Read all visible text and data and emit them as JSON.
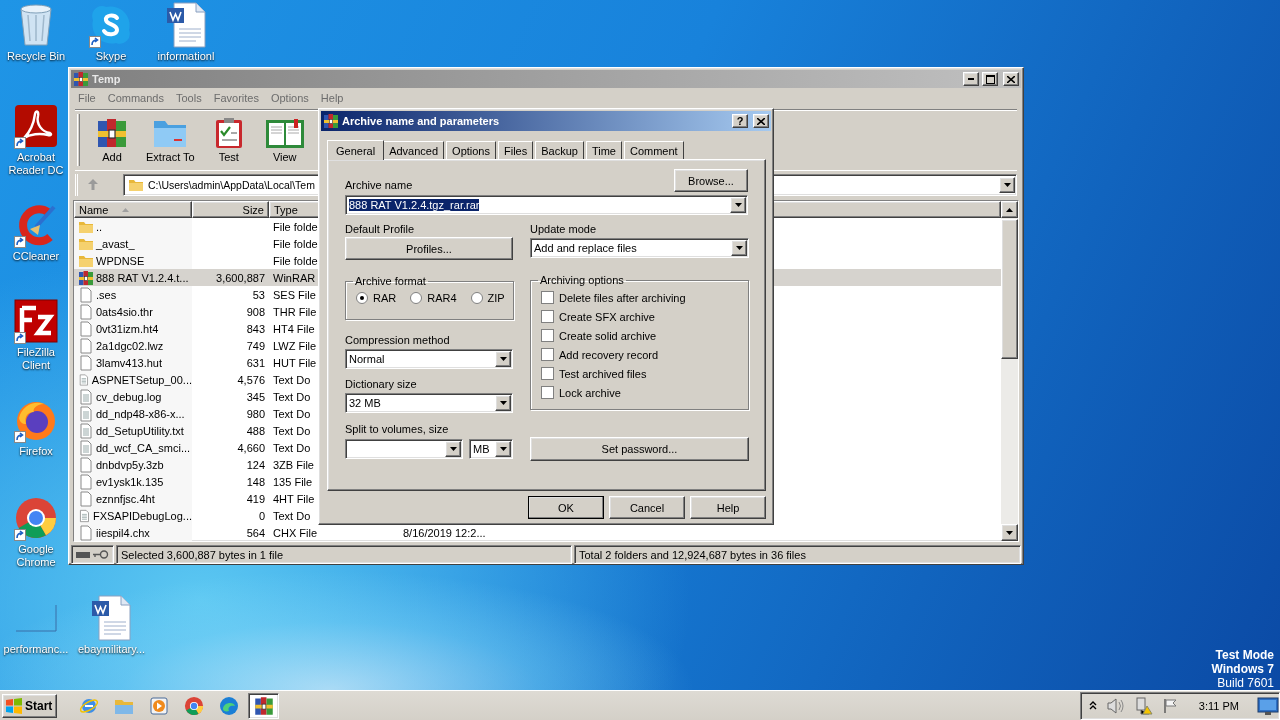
{
  "desktop_icons": [
    {
      "kind": "recycle",
      "label": "Recycle Bin",
      "shortcut": false
    },
    {
      "kind": "chat",
      "label": "Skype",
      "shortcut": true
    },
    {
      "kind": "document",
      "label": "informationl",
      "shortcut": false
    },
    {
      "kind": "pdf",
      "label": "Acrobat Reader DC",
      "shortcut": true
    },
    {
      "kind": "cleaner",
      "label": "CCleaner",
      "shortcut": true
    },
    {
      "kind": "ftp",
      "label": "FileZilla Client",
      "shortcut": true
    },
    {
      "kind": "firefox",
      "label": "Firefox",
      "shortcut": true
    },
    {
      "kind": "chrome",
      "label": "Google Chrome",
      "shortcut": true
    },
    {
      "kind": "blank",
      "label": "performanc...",
      "shortcut": false
    },
    {
      "kind": "document",
      "label": "ebaymilitary...",
      "shortcut": false
    }
  ],
  "main_window": {
    "title": "Temp",
    "menu": [
      "File",
      "Commands",
      "Tools",
      "Favorites",
      "Options",
      "Help"
    ],
    "toolbar": [
      {
        "kind": "add",
        "label": "Add"
      },
      {
        "kind": "extract",
        "label": "Extract To"
      },
      {
        "kind": "test",
        "label": "Test"
      },
      {
        "kind": "view",
        "label": "View"
      }
    ],
    "path": "C:\\Users\\admin\\AppData\\Local\\Tem",
    "columns": [
      "Name",
      "Size",
      "Type"
    ],
    "files": [
      {
        "kind": "folder",
        "name": "..",
        "type": "File folde",
        "selected": false
      },
      {
        "kind": "folder",
        "name": "_avast_",
        "type": "File folde",
        "selected": false
      },
      {
        "kind": "folder",
        "name": "WPDNSE",
        "type": "File folde",
        "selected": false
      },
      {
        "kind": "archive",
        "name": "888 RAT V1.2.4.t...",
        "size": "3,600,887",
        "type": "WinRAR",
        "selected": true
      },
      {
        "kind": "file",
        "name": ".ses",
        "size": "53",
        "type": "SES File",
        "selected": false
      },
      {
        "kind": "file",
        "name": "0ats4sio.thr",
        "size": "908",
        "type": "THR File",
        "selected": false
      },
      {
        "kind": "file",
        "name": "0vt31izm.ht4",
        "size": "843",
        "type": "HT4 File",
        "selected": false
      },
      {
        "kind": "file",
        "name": "2a1dgc02.lwz",
        "size": "749",
        "type": "LWZ File",
        "selected": false
      },
      {
        "kind": "file",
        "name": "3lamv413.hut",
        "size": "631",
        "type": "HUT File",
        "selected": false
      },
      {
        "kind": "text",
        "name": "ASPNETSetup_00...",
        "size": "4,576",
        "type": "Text Do",
        "selected": false
      },
      {
        "kind": "text",
        "name": "cv_debug.log",
        "size": "345",
        "type": "Text Do",
        "selected": false
      },
      {
        "kind": "text",
        "name": "dd_ndp48-x86-x...",
        "size": "980",
        "type": "Text Do",
        "selected": false
      },
      {
        "kind": "text",
        "name": "dd_SetupUtility.txt",
        "size": "488",
        "type": "Text Do",
        "selected": false
      },
      {
        "kind": "text",
        "name": "dd_wcf_CA_smci...",
        "size": "4,660",
        "type": "Text Do",
        "selected": false
      },
      {
        "kind": "file",
        "name": "dnbdvp5y.3zb",
        "size": "124",
        "type": "3ZB File",
        "selected": false
      },
      {
        "kind": "file",
        "name": "ev1ysk1k.135",
        "size": "148",
        "type": "135 File",
        "selected": false
      },
      {
        "kind": "file",
        "name": "eznnfjsc.4ht",
        "size": "419",
        "type": "4HT File",
        "selected": false
      },
      {
        "kind": "text",
        "name": "FXSAPIDebugLog...",
        "size": "0",
        "type": "Text Do",
        "selected": false
      },
      {
        "kind": "file",
        "name": "iiespil4.chx",
        "size": "564",
        "type": "CHX File",
        "modified": "8/16/2019 12:2...",
        "selected": false
      }
    ],
    "status_left": "Selected 3,600,887 bytes in 1 file",
    "status_right": "Total 2 folders and 12,924,687 bytes in 36 files"
  },
  "dialog": {
    "title": "Archive name and parameters",
    "help_glyph": "?",
    "tabs": [
      {
        "label": "General",
        "selected": true
      },
      {
        "label": "Advanced",
        "selected": false
      },
      {
        "label": "Options",
        "selected": false
      },
      {
        "label": "Files",
        "selected": false
      },
      {
        "label": "Backup",
        "selected": false
      },
      {
        "label": "Time",
        "selected": false
      },
      {
        "label": "Comment",
        "selected": false
      }
    ],
    "browse_button": "Browse...",
    "archive_name": {
      "label": "Archive name",
      "value": "888 RAT V1.2.4.tgz_rar.rar",
      "highlighted": true
    },
    "default_profile": {
      "label": "Default Profile",
      "button": "Profiles..."
    },
    "update_mode": {
      "label": "Update mode",
      "value": "Add and replace files"
    },
    "archive_format": {
      "label": "Archive format",
      "options": [
        {
          "label": "RAR",
          "selected": true
        },
        {
          "label": "RAR4",
          "selected": false
        },
        {
          "label": "ZIP",
          "selected": false
        }
      ]
    },
    "compression_method": {
      "label": "Compression method",
      "value": "Normal"
    },
    "dictionary_size": {
      "label": "Dictionary size",
      "value": "32 MB"
    },
    "split_volumes": {
      "label": "Split to volumes, size",
      "unit": "MB"
    },
    "archiving_options": {
      "label": "Archiving options",
      "options": [
        {
          "label": "Delete files after archiving",
          "checked": false
        },
        {
          "label": "Create SFX archive",
          "checked": false
        },
        {
          "label": "Create solid archive",
          "checked": false
        },
        {
          "label": "Add recovery record",
          "checked": false
        },
        {
          "label": "Test archived files",
          "checked": false
        },
        {
          "label": "Lock archive",
          "checked": false
        }
      ]
    },
    "password_button": "Set password...",
    "buttons": [
      "OK",
      "Cancel",
      "Help"
    ]
  },
  "taskbar": {
    "start": "Start",
    "apps": [
      {
        "kind": "ie",
        "active": false
      },
      {
        "kind": "explorer",
        "active": false
      },
      {
        "kind": "media",
        "active": false
      },
      {
        "kind": "chrome",
        "active": false
      },
      {
        "kind": "edge",
        "active": false
      },
      {
        "kind": "winrar",
        "active": true
      }
    ],
    "clock": "3:11 PM"
  },
  "os_notice": [
    {
      "text": "Test Mode",
      "bold": true
    },
    {
      "text": "Windows 7",
      "bold": true
    },
    {
      "text": "Build 7601",
      "bold": false
    }
  ]
}
